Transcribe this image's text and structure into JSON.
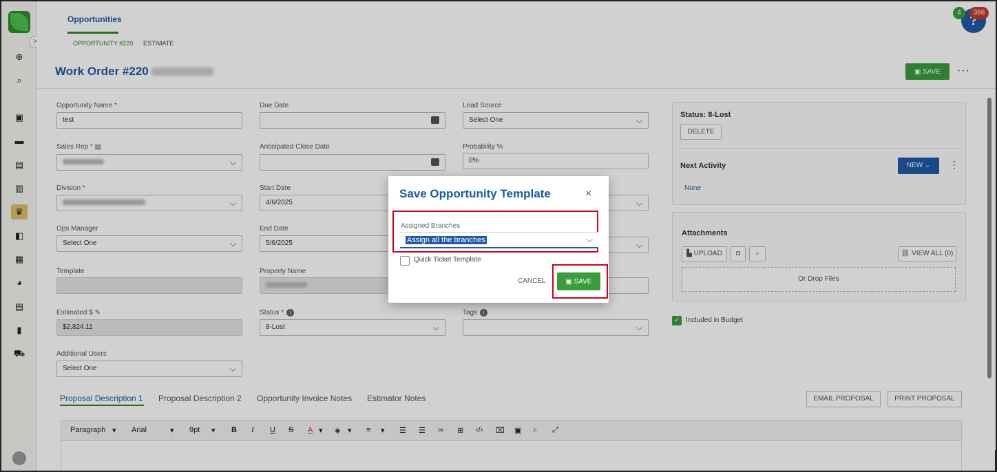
{
  "nav": {
    "tab_main": "Opportunities",
    "subtabs": [
      "OPPORTUNITY #220",
      "ESTIMATE"
    ],
    "badge_green": "4",
    "badge_red": "366",
    "help_glyph": "?",
    "expand_glyph": ">"
  },
  "header": {
    "title": "Work Order #220",
    "save_label": "SAVE",
    "more_glyph": "···"
  },
  "form": {
    "opportunity_name_label": "Opportunity Name",
    "opportunity_name_value": "test",
    "due_date_label": "Due Date",
    "lead_source_label": "Lead Source",
    "lead_source_value": "Select One",
    "sales_rep_label": "Sales Rep",
    "anticipated_close_label": "Anticipated Close Date",
    "probability_label": "Probability %",
    "probability_value": "0%",
    "division_label": "Division",
    "start_date_label": "Start Date",
    "start_date_value": "4/6/2025",
    "ops_manager_label": "Ops Manager",
    "ops_manager_value": "Select One",
    "end_date_label": "End Date",
    "end_date_value": "5/6/2025",
    "template_label": "Template",
    "property_name_label": "Property Name",
    "estimated_label": "Estimated $",
    "estimated_value": "$2,824.11",
    "status_label": "Status",
    "status_value": "8-Lost",
    "tags_label": "Tags",
    "additional_users_label": "Additional Users",
    "additional_users_value": "Select One",
    "required_mark": "*"
  },
  "right_panel": {
    "status_text": "Status: 8-Lost",
    "delete_label": "DELETE",
    "next_activity_label": "Next Activity",
    "new_label": "NEW",
    "next_activity_value": "None",
    "attachments_label": "Attachments",
    "upload_label": "UPLOAD",
    "view_all_label": "VIEW ALL (0)",
    "drop_files_label": "Or Drop Files",
    "included_budget_label": "Included in Budget"
  },
  "tabs": {
    "items": [
      "Proposal Description 1",
      "Proposal Description 2",
      "Opportunity Invoice Notes",
      "Estimator Notes"
    ],
    "email_proposal": "EMAIL PROPOSAL",
    "print_proposal": "PRINT PROPOSAL"
  },
  "editor": {
    "paragraph": "Paragraph",
    "font": "Arial",
    "size": "9pt"
  },
  "modal": {
    "title": "Save Opportunity Template",
    "close_glyph": "×",
    "assigned_branches_label": "Assigned Branches",
    "assigned_branches_value": "Assign all the branches",
    "quick_ticket_label": "Quick Ticket Template",
    "cancel_label": "CANCEL",
    "save_label": "SAVE"
  },
  "colors": {
    "accent_blue": "#1e5aa6",
    "accent_green": "#3a9d3a",
    "highlight_red": "#d0021b"
  }
}
